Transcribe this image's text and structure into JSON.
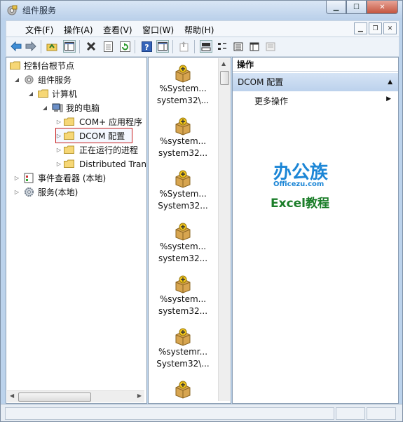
{
  "window": {
    "title": "组件服务"
  },
  "menu": [
    "文件(F)",
    "操作(A)",
    "查看(V)",
    "窗口(W)",
    "帮助(H)"
  ],
  "tree": {
    "root": "控制台根节点",
    "component_services": "组件服务",
    "computers": "计算机",
    "my_computer": "我的电脑",
    "com_apps": "COM+ 应用程序",
    "dcom_config": "DCOM 配置",
    "running_processes": "正在运行的进程",
    "distributed_tx": "Distributed Tran",
    "event_viewer": "事件查看器 (本地)",
    "services": "服务(本地)"
  },
  "items": [
    {
      "line1": "%System...",
      "line2": "system32\\..."
    },
    {
      "line1": "%system...",
      "line2": "system32..."
    },
    {
      "line1": "%System...",
      "line2": "System32..."
    },
    {
      "line1": "%system...",
      "line2": "system32..."
    },
    {
      "line1": "%system...",
      "line2": "system32..."
    },
    {
      "line1": "%systemr...",
      "line2": "System32\\..."
    }
  ],
  "actions": {
    "header": "操作",
    "section": "DCOM 配置",
    "more": "更多操作"
  },
  "watermark": {
    "brand": "办公族",
    "url": "Officezu.com",
    "tagline": "Excel教程"
  },
  "colors": {
    "selection_border": "#c81d1d",
    "action_section": "#c7d8ee",
    "watermark_blue": "#1c86d6",
    "watermark_green": "#1a7d28"
  }
}
